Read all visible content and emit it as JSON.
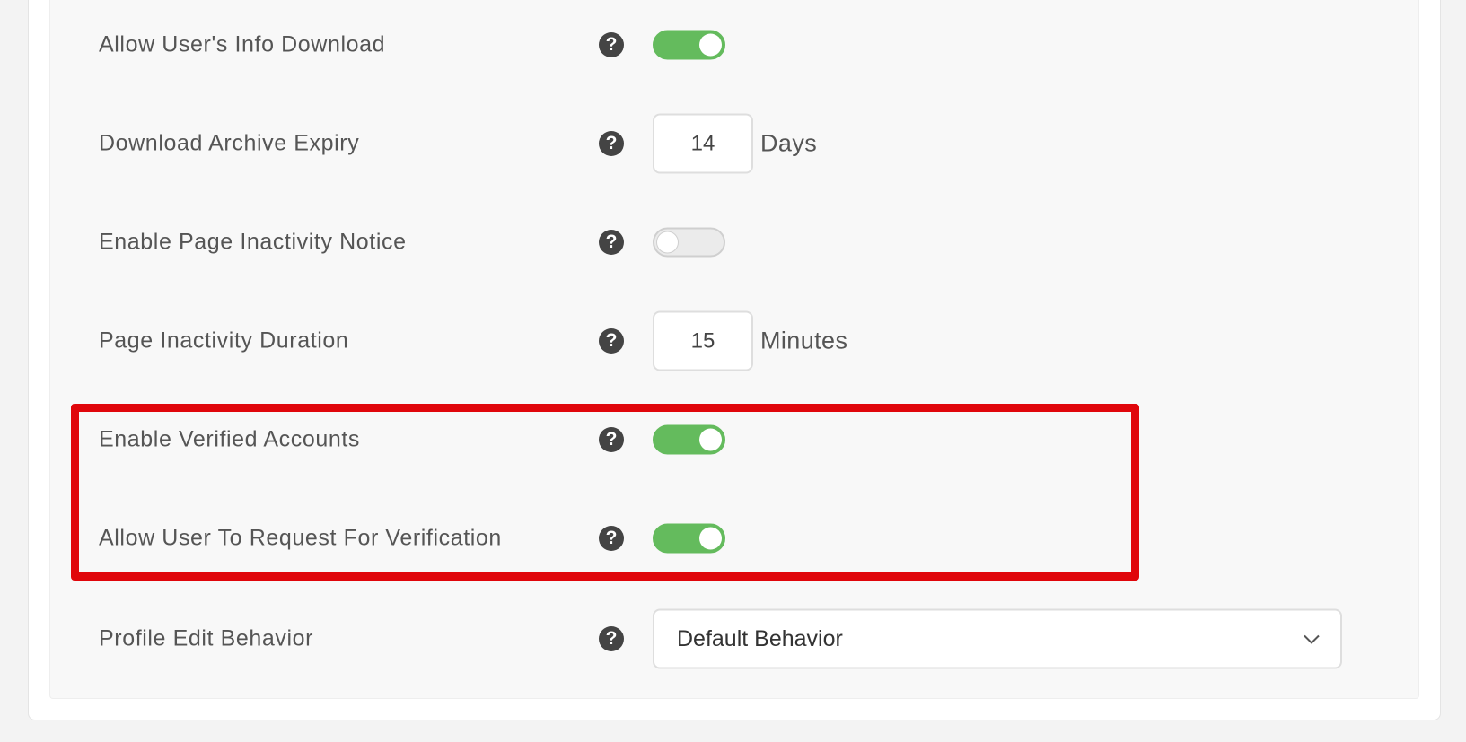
{
  "settings": {
    "allow_info_download": {
      "label": "Allow User's Info Download",
      "enabled": true
    },
    "archive_expiry": {
      "label": "Download Archive Expiry",
      "value": "14",
      "unit": "Days"
    },
    "inactivity_notice": {
      "label": "Enable Page Inactivity Notice",
      "enabled": false
    },
    "inactivity_duration": {
      "label": "Page Inactivity Duration",
      "value": "15",
      "unit": "Minutes"
    },
    "verified_accounts": {
      "label": "Enable Verified Accounts",
      "enabled": true
    },
    "request_verification": {
      "label": "Allow User To Request For Verification",
      "enabled": true
    },
    "profile_edit_behavior": {
      "label": "Profile Edit Behavior",
      "selected": "Default Behavior"
    }
  },
  "help_icon_glyph": "?",
  "icons": {
    "help": "question-circle-icon",
    "dropdown": "chevron-down-icon"
  },
  "colors": {
    "toggle_on": "#64bb5d",
    "toggle_off": "#ebebeb",
    "highlight_border": "#e0060b",
    "help_icon": "#444444"
  }
}
